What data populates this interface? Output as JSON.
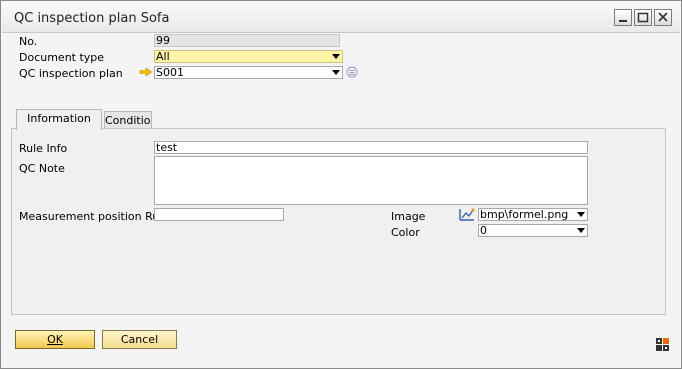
{
  "window": {
    "title": "QC inspection plan Sofa"
  },
  "header": {
    "no_label": "No.",
    "no_value": "99",
    "doctype_label": "Document type",
    "doctype_value": "All",
    "plan_label": "QC inspection plan",
    "plan_value": "S001"
  },
  "tabs": [
    {
      "label": "Information",
      "active": true
    },
    {
      "label": "Conditior",
      "active": false
    }
  ],
  "info": {
    "rule_info_label": "Rule Info",
    "rule_info_value": "test",
    "qc_note_label": "QC Note",
    "qc_note_value": "",
    "measure_label": "Measurement position Rule",
    "measure_value": "",
    "image_label": "Image",
    "image_value": "bmp\\formel.png",
    "color_label": "Color",
    "color_value": "0"
  },
  "footer": {
    "ok_label": "OK",
    "cancel_label": "Cancel"
  },
  "colors": {
    "button_accent": "#f2c950",
    "link_arrow": "#f0c000",
    "required_yellow": "#fff4a8"
  }
}
